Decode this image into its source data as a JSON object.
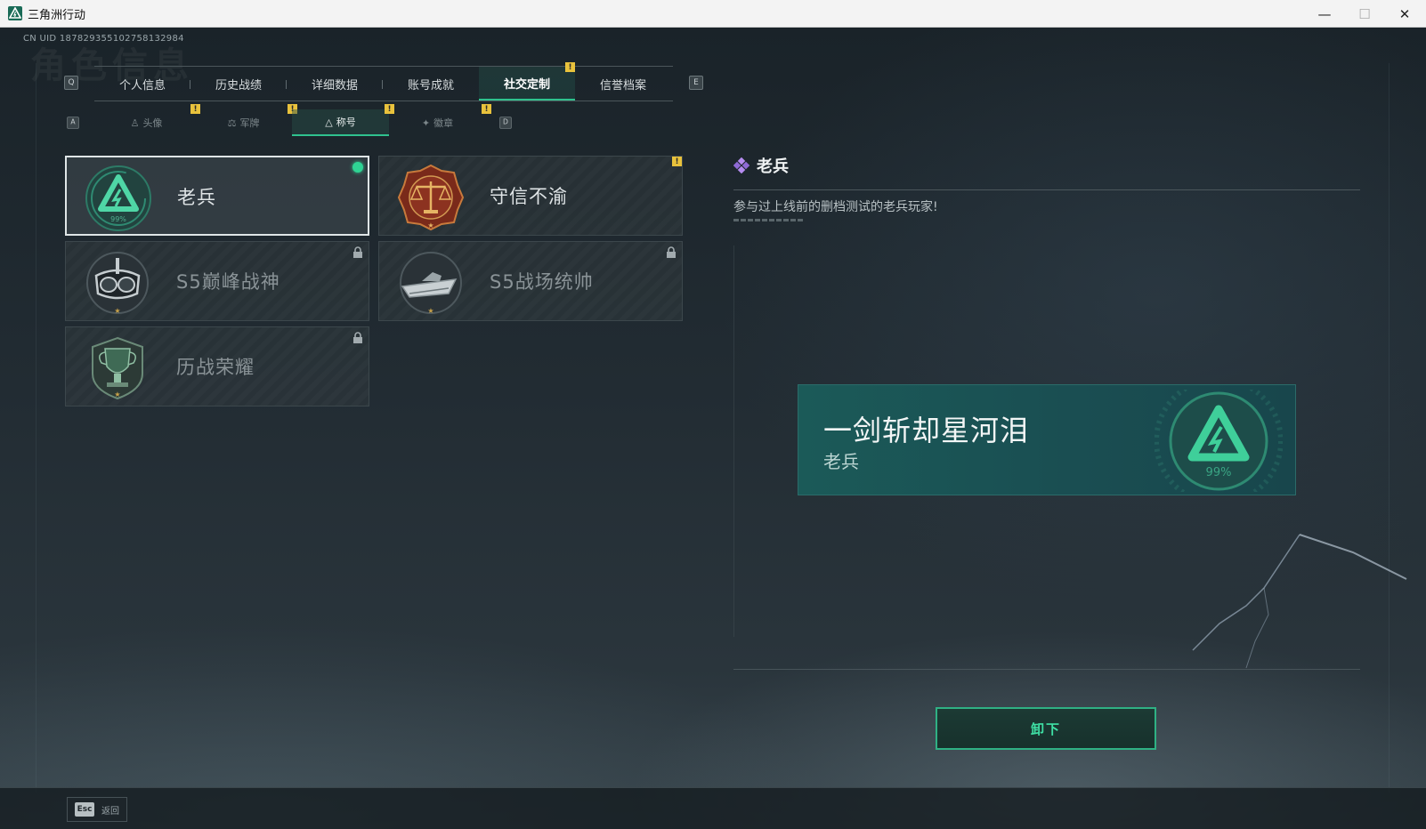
{
  "window": {
    "title": "三角洲行动",
    "controls": {
      "minimize": "—",
      "maximize": "☐",
      "close": "✕"
    }
  },
  "header": {
    "uid": "CN UID 187829355102758132984",
    "watermark": "角色信息"
  },
  "main_tabs": {
    "prev_key": "Q",
    "next_key": "E",
    "items": [
      {
        "label": "个人信息",
        "active": false
      },
      {
        "label": "历史战绩",
        "active": false
      },
      {
        "label": "详细数据",
        "active": false
      },
      {
        "label": "账号成就",
        "active": false
      },
      {
        "label": "社交定制",
        "active": true,
        "notification": "!"
      },
      {
        "label": "信誉档案",
        "active": false
      }
    ]
  },
  "sub_tabs": {
    "prev_key": "A",
    "next_key": "D",
    "items": [
      {
        "label": "头像",
        "icon": "person-icon",
        "active": false,
        "notification": "!"
      },
      {
        "label": "军牌",
        "icon": "dogtag-icon",
        "active": false,
        "notification": "!"
      },
      {
        "label": "称号",
        "icon": "title-icon",
        "active": true,
        "notification": "!"
      },
      {
        "label": "徽章",
        "icon": "badge-icon",
        "active": false,
        "notification": "!"
      }
    ]
  },
  "titles": [
    {
      "name": "老兵",
      "emblem": "veteran-emblem-icon",
      "emblem_text": "99%",
      "selected": true,
      "equipped": true,
      "locked": false
    },
    {
      "name": "守信不渝",
      "emblem": "scales-emblem-icon",
      "selected": false,
      "equipped": false,
      "locked": false,
      "notification": "!"
    },
    {
      "name": "S5巅峰战神",
      "emblem": "diver-mask-emblem-icon",
      "selected": false,
      "equipped": false,
      "locked": true
    },
    {
      "name": "S5战场统帅",
      "emblem": "speedboat-emblem-icon",
      "selected": false,
      "equipped": false,
      "locked": true
    },
    {
      "name": "历战荣耀",
      "emblem": "trophy-emblem-icon",
      "selected": false,
      "equipped": false,
      "locked": true
    }
  ],
  "detail": {
    "title": "老兵",
    "description": "参与过上线前的删档测试的老兵玩家!"
  },
  "preview": {
    "player_name": "一剑斩却星河泪",
    "title": "老兵",
    "emblem_text": "99%"
  },
  "action_button": {
    "label": "卸下"
  },
  "footer": {
    "esc_key": "Esc",
    "esc_label": "返回"
  },
  "colors": {
    "accent": "#2fc28e",
    "notification": "#e9c23c",
    "preview_bg": "#1b5a58"
  }
}
